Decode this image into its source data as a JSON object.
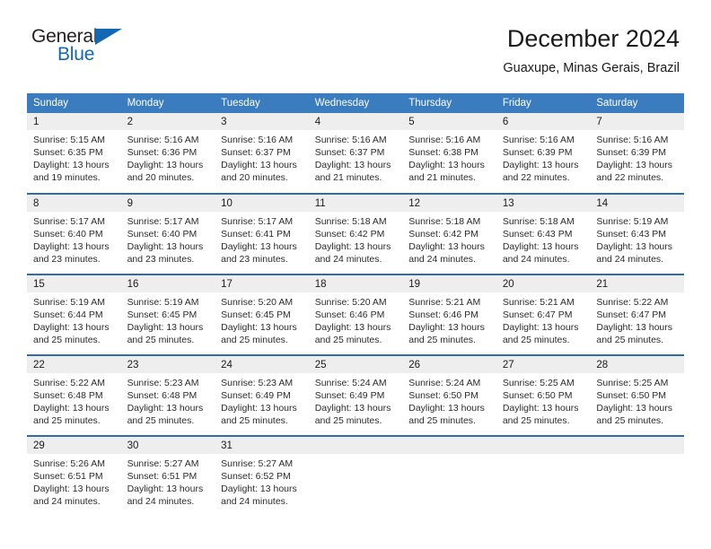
{
  "brand": {
    "name_part1": "General",
    "name_part2": "Blue",
    "accent_color": "#1268b3"
  },
  "header": {
    "title": "December 2024",
    "subtitle": "Guaxupe, Minas Gerais, Brazil"
  },
  "calendar": {
    "header_bg": "#3a7cbe",
    "row_divider_color": "#2f6ca8",
    "daynum_bg": "#eeeeee",
    "weekday_headers": [
      "Sunday",
      "Monday",
      "Tuesday",
      "Wednesday",
      "Thursday",
      "Friday",
      "Saturday"
    ],
    "labels": {
      "sunrise": "Sunrise:",
      "sunset": "Sunset:",
      "daylight": "Daylight:"
    },
    "weeks": [
      [
        {
          "day": "1",
          "sunrise": "Sunrise: 5:15 AM",
          "sunset": "Sunset: 6:35 PM",
          "daylight": "Daylight: 13 hours and 19 minutes."
        },
        {
          "day": "2",
          "sunrise": "Sunrise: 5:16 AM",
          "sunset": "Sunset: 6:36 PM",
          "daylight": "Daylight: 13 hours and 20 minutes."
        },
        {
          "day": "3",
          "sunrise": "Sunrise: 5:16 AM",
          "sunset": "Sunset: 6:37 PM",
          "daylight": "Daylight: 13 hours and 20 minutes."
        },
        {
          "day": "4",
          "sunrise": "Sunrise: 5:16 AM",
          "sunset": "Sunset: 6:37 PM",
          "daylight": "Daylight: 13 hours and 21 minutes."
        },
        {
          "day": "5",
          "sunrise": "Sunrise: 5:16 AM",
          "sunset": "Sunset: 6:38 PM",
          "daylight": "Daylight: 13 hours and 21 minutes."
        },
        {
          "day": "6",
          "sunrise": "Sunrise: 5:16 AM",
          "sunset": "Sunset: 6:39 PM",
          "daylight": "Daylight: 13 hours and 22 minutes."
        },
        {
          "day": "7",
          "sunrise": "Sunrise: 5:16 AM",
          "sunset": "Sunset: 6:39 PM",
          "daylight": "Daylight: 13 hours and 22 minutes."
        }
      ],
      [
        {
          "day": "8",
          "sunrise": "Sunrise: 5:17 AM",
          "sunset": "Sunset: 6:40 PM",
          "daylight": "Daylight: 13 hours and 23 minutes."
        },
        {
          "day": "9",
          "sunrise": "Sunrise: 5:17 AM",
          "sunset": "Sunset: 6:40 PM",
          "daylight": "Daylight: 13 hours and 23 minutes."
        },
        {
          "day": "10",
          "sunrise": "Sunrise: 5:17 AM",
          "sunset": "Sunset: 6:41 PM",
          "daylight": "Daylight: 13 hours and 23 minutes."
        },
        {
          "day": "11",
          "sunrise": "Sunrise: 5:18 AM",
          "sunset": "Sunset: 6:42 PM",
          "daylight": "Daylight: 13 hours and 24 minutes."
        },
        {
          "day": "12",
          "sunrise": "Sunrise: 5:18 AM",
          "sunset": "Sunset: 6:42 PM",
          "daylight": "Daylight: 13 hours and 24 minutes."
        },
        {
          "day": "13",
          "sunrise": "Sunrise: 5:18 AM",
          "sunset": "Sunset: 6:43 PM",
          "daylight": "Daylight: 13 hours and 24 minutes."
        },
        {
          "day": "14",
          "sunrise": "Sunrise: 5:19 AM",
          "sunset": "Sunset: 6:43 PM",
          "daylight": "Daylight: 13 hours and 24 minutes."
        }
      ],
      [
        {
          "day": "15",
          "sunrise": "Sunrise: 5:19 AM",
          "sunset": "Sunset: 6:44 PM",
          "daylight": "Daylight: 13 hours and 25 minutes."
        },
        {
          "day": "16",
          "sunrise": "Sunrise: 5:19 AM",
          "sunset": "Sunset: 6:45 PM",
          "daylight": "Daylight: 13 hours and 25 minutes."
        },
        {
          "day": "17",
          "sunrise": "Sunrise: 5:20 AM",
          "sunset": "Sunset: 6:45 PM",
          "daylight": "Daylight: 13 hours and 25 minutes."
        },
        {
          "day": "18",
          "sunrise": "Sunrise: 5:20 AM",
          "sunset": "Sunset: 6:46 PM",
          "daylight": "Daylight: 13 hours and 25 minutes."
        },
        {
          "day": "19",
          "sunrise": "Sunrise: 5:21 AM",
          "sunset": "Sunset: 6:46 PM",
          "daylight": "Daylight: 13 hours and 25 minutes."
        },
        {
          "day": "20",
          "sunrise": "Sunrise: 5:21 AM",
          "sunset": "Sunset: 6:47 PM",
          "daylight": "Daylight: 13 hours and 25 minutes."
        },
        {
          "day": "21",
          "sunrise": "Sunrise: 5:22 AM",
          "sunset": "Sunset: 6:47 PM",
          "daylight": "Daylight: 13 hours and 25 minutes."
        }
      ],
      [
        {
          "day": "22",
          "sunrise": "Sunrise: 5:22 AM",
          "sunset": "Sunset: 6:48 PM",
          "daylight": "Daylight: 13 hours and 25 minutes."
        },
        {
          "day": "23",
          "sunrise": "Sunrise: 5:23 AM",
          "sunset": "Sunset: 6:48 PM",
          "daylight": "Daylight: 13 hours and 25 minutes."
        },
        {
          "day": "24",
          "sunrise": "Sunrise: 5:23 AM",
          "sunset": "Sunset: 6:49 PM",
          "daylight": "Daylight: 13 hours and 25 minutes."
        },
        {
          "day": "25",
          "sunrise": "Sunrise: 5:24 AM",
          "sunset": "Sunset: 6:49 PM",
          "daylight": "Daylight: 13 hours and 25 minutes."
        },
        {
          "day": "26",
          "sunrise": "Sunrise: 5:24 AM",
          "sunset": "Sunset: 6:50 PM",
          "daylight": "Daylight: 13 hours and 25 minutes."
        },
        {
          "day": "27",
          "sunrise": "Sunrise: 5:25 AM",
          "sunset": "Sunset: 6:50 PM",
          "daylight": "Daylight: 13 hours and 25 minutes."
        },
        {
          "day": "28",
          "sunrise": "Sunrise: 5:25 AM",
          "sunset": "Sunset: 6:50 PM",
          "daylight": "Daylight: 13 hours and 25 minutes."
        }
      ],
      [
        {
          "day": "29",
          "sunrise": "Sunrise: 5:26 AM",
          "sunset": "Sunset: 6:51 PM",
          "daylight": "Daylight: 13 hours and 24 minutes."
        },
        {
          "day": "30",
          "sunrise": "Sunrise: 5:27 AM",
          "sunset": "Sunset: 6:51 PM",
          "daylight": "Daylight: 13 hours and 24 minutes."
        },
        {
          "day": "31",
          "sunrise": "Sunrise: 5:27 AM",
          "sunset": "Sunset: 6:52 PM",
          "daylight": "Daylight: 13 hours and 24 minutes."
        },
        {
          "day": "",
          "sunrise": "",
          "sunset": "",
          "daylight": ""
        },
        {
          "day": "",
          "sunrise": "",
          "sunset": "",
          "daylight": ""
        },
        {
          "day": "",
          "sunrise": "",
          "sunset": "",
          "daylight": ""
        },
        {
          "day": "",
          "sunrise": "",
          "sunset": "",
          "daylight": ""
        }
      ]
    ]
  }
}
